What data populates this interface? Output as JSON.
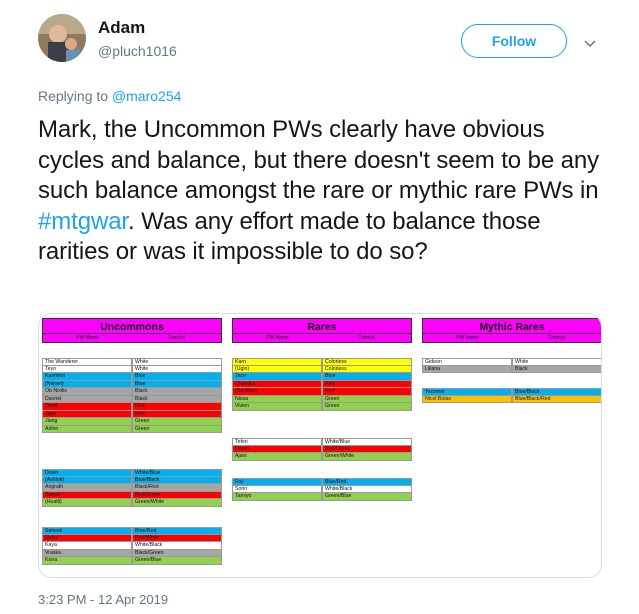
{
  "tweet": {
    "author_name": "Adam",
    "author_handle": "@pluch1016",
    "follow_label": "Follow",
    "reply_prefix": "Replying to",
    "reply_to": "@maro254",
    "text_part1": "Mark, the Uncommon PWs clearly have obvious cycles and balance, but there doesn't seem to be any such balance amongst the rare or mythic rare PWs in",
    "hashtag": "#mtgwar",
    "text_part2": ".  Was any effort made to balance those rarities or was it impossible to do so?",
    "timestamp": "3:23 PM - 12 Apr 2019"
  },
  "colors": {
    "White": "#ffffff",
    "Blue": "#00b0f0",
    "Black": "#a6a6a6",
    "Red": "#ff0000",
    "Green": "#92d050",
    "Colorless": "#ffff00",
    "Gold": "#ffc000"
  },
  "table": {
    "sub_name": "PW Name",
    "sub_color": "Color(s)",
    "columns": [
      {
        "title": "Uncommons",
        "groups": [
          [
            {
              "name": "The Wanderer",
              "color": "White",
              "fill": "White"
            },
            {
              "name": "Teyo",
              "color": "White",
              "fill": "White"
            },
            {
              "name": "Kasmina",
              "color": "Blue",
              "fill": "Blue"
            },
            {
              "name": "(Narset)",
              "color": "Blue",
              "fill": "Blue"
            },
            {
              "name": "Ob Nixilis",
              "color": "Black",
              "fill": "Black"
            },
            {
              "name": "Davriel",
              "color": "Black",
              "fill": "Black"
            },
            {
              "name": "Tibalt",
              "color": "Red",
              "fill": "Red"
            },
            {
              "name": "Jaya",
              "color": "Red",
              "fill": "Red"
            },
            {
              "name": "Jiang",
              "color": "Green",
              "fill": "Green"
            },
            {
              "name": "Arlinn",
              "color": "Green",
              "fill": "Green"
            }
          ],
          [
            {
              "name": "Dovin",
              "color": "White/Blue",
              "fill": "Blue"
            },
            {
              "name": "(Ashiok)",
              "color": "Blue/Black",
              "fill": "Blue"
            },
            {
              "name": "Angrath",
              "color": "Black/Red",
              "fill": "Black"
            },
            {
              "name": "Samut",
              "color": "Red/Green",
              "fill": "Red"
            },
            {
              "name": "(Huatli)",
              "color": "Green/White",
              "fill": "Green"
            }
          ],
          [
            {
              "name": "Saheeli",
              "color": "Blue/Red",
              "fill": "Blue"
            },
            {
              "name": "Nahiri",
              "color": "Red/White",
              "fill": "Red"
            },
            {
              "name": "Kaya",
              "color": "White/Black",
              "fill": "White"
            },
            {
              "name": "Vraska",
              "color": "Black/Green",
              "fill": "Black"
            },
            {
              "name": "Kiora",
              "color": "Green/Blue",
              "fill": "Green"
            }
          ]
        ]
      },
      {
        "title": "Rares",
        "groups": [
          [
            {
              "name": "Karn",
              "color": "Colorless",
              "fill": "Colorless"
            },
            {
              "name": "(Ugin)",
              "color": "Colorless",
              "fill": "Colorless"
            },
            {
              "name": "Jace",
              "color": "Blue",
              "fill": "Blue"
            },
            {
              "name": "Chandra",
              "color": "Red",
              "fill": "Red"
            },
            {
              "name": "(Sarkhan)",
              "color": "Red",
              "fill": "Red"
            },
            {
              "name": "Nissa",
              "color": "Green",
              "fill": "Green"
            },
            {
              "name": "Vivien",
              "color": "Green",
              "fill": "Green"
            }
          ],
          [
            {
              "name": "Teferi",
              "color": "White/Blue",
              "fill": "White"
            },
            {
              "name": "Domri",
              "color": "Red/Green",
              "fill": "Red"
            },
            {
              "name": "Ajani",
              "color": "Green/White",
              "fill": "Green"
            }
          ],
          [
            {
              "name": "Ral",
              "color": "Blue/Red",
              "fill": "Blue"
            },
            {
              "name": "Sorin",
              "color": "White/Black",
              "fill": "White"
            },
            {
              "name": "Tamiyo",
              "color": "Green/Blue",
              "fill": "Green"
            }
          ]
        ]
      },
      {
        "title": "Mythic Rares",
        "groups": [
          [
            {
              "name": "Gideon",
              "color": "White",
              "fill": "White"
            },
            {
              "name": "Liliana",
              "color": "Black",
              "fill": "Black"
            }
          ],
          [
            {
              "name": "Tezzeret",
              "color": "Blue/Black",
              "fill": "Blue"
            },
            {
              "name": "Nicol Bolas",
              "color": "Blue/Black/Red",
              "fill": "Gold"
            }
          ]
        ]
      }
    ]
  }
}
